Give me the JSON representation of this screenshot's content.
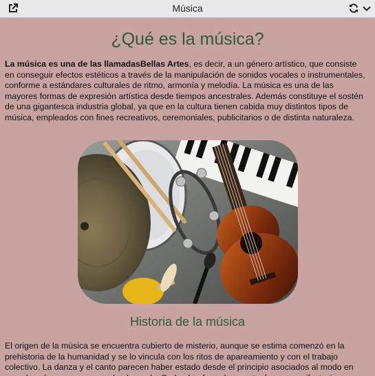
{
  "window": {
    "title": "Música",
    "icons": [
      "open-external-icon",
      "refresh-icon",
      "chevron-down-icon"
    ]
  },
  "article": {
    "heading": "¿Qué es la música?",
    "intro_bold": "La música es una de las llamadasBellas Artes",
    "intro_rest": ", es decir, a un género artístico, que consiste en conseguir efectos estéticos a través de la manipulación de sonidos vocales o instrumentales, conforme a estándares culturales de ritmo, armonía y melodía. La música es una de las mayores formas de expresión artística desde tiempos ancestrales. Además constituye el sostén de una gigantesca industria global, ya que en la cultura tienen cabida muy distintos tipos de música, empleados con fines recreativos, ceremoniales, publicitarios o de distinta naturaleza.",
    "image_subject": "musical instruments collage",
    "history_heading": "Historia de la música",
    "history_text": "El origen de la música se encuentra cubierto de misterio, aunque se estima comenzó en la prehistoria de la humanidad y se lo vincula con los ritos de apareamiento y con el trabajo colectivo. La danza y el canto parecen haber estado desde el principio asociados al modo en que el ser humano comprende el mundo. De hecho, formaban parte de sus manifestaciones"
  },
  "colors": {
    "page_background": "#c9a3a1",
    "heading_green": "#2f5a3a",
    "topbar": "#e9e9e9"
  }
}
